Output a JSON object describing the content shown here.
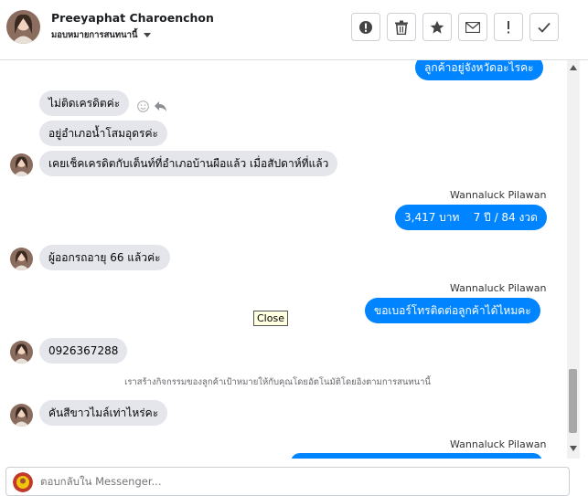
{
  "header": {
    "contact_name": "Preeyaphat Charoenchon",
    "assign_label": "มอบหมายการสนทนานี้"
  },
  "toolbar": {
    "buttons": [
      {
        "name": "mark-spam-button",
        "icon": "exclamation-circle-icon"
      },
      {
        "name": "delete-button",
        "icon": "trash-icon"
      },
      {
        "name": "star-button",
        "icon": "star-icon"
      },
      {
        "name": "mark-unread-button",
        "icon": "envelope-icon"
      },
      {
        "name": "follow-up-button",
        "icon": "exclamation-icon"
      },
      {
        "name": "mark-done-button",
        "icon": "check-icon"
      }
    ]
  },
  "messages": [
    {
      "dir": "out",
      "text": "ลูกค้าอยู่จังหวัดอะไรคะ"
    },
    {
      "dir": "in",
      "text": "ไม่ติดเครดิตค่ะ"
    },
    {
      "dir": "in",
      "text": "อยู่อำเภอน้ำโสมอุดรค่ะ"
    },
    {
      "dir": "in",
      "text": "เคยเช็คเครดิตกับเต็นท์ที่อำเภอบ้านผือแล้ว เมื่อสัปดาห์ที่แล้ว"
    },
    {
      "dir": "out",
      "sender": "Wannaluck Pilawan",
      "text": "3,417 บาท    7 ปี / 84 งวด"
    },
    {
      "dir": "in",
      "text": "ผู้ออกรถอายุ 66 แล้วค่ะ"
    },
    {
      "dir": "out",
      "sender": "Wannaluck Pilawan",
      "text": "ขอเบอร์โทรติดต่อลูกค้าได้ไหมคะ"
    },
    {
      "dir": "in",
      "text": "0926367288"
    },
    {
      "dir": "system",
      "text": "เราสร้างกิจกรรมของลูกค้าเป้าหมายให้กับคุณโดยอัตโนมัติโดยอิงตามการสนทนานี้"
    },
    {
      "dir": "in",
      "text": "คันสีขาวไมล์เท่าไหร่คะ"
    },
    {
      "dir": "out",
      "sender": "Wannaluck Pilawan",
      "text": ""
    }
  ],
  "tooltip": "Close",
  "composer": {
    "placeholder": "ตอบกลับใน Messenger..."
  },
  "colors": {
    "outgoing_bubble": "#0084ff",
    "incoming_bubble": "#e4e6eb"
  }
}
